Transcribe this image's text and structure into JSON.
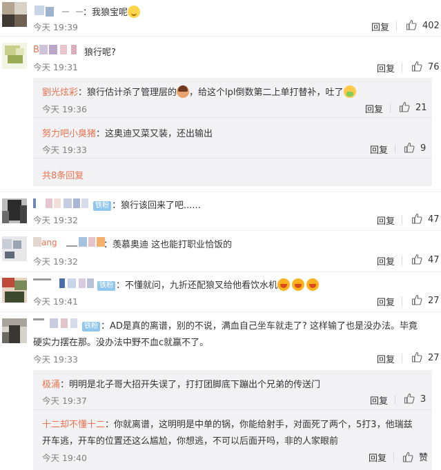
{
  "comments": [
    {
      "text": "我狼宝呢",
      "time": "今天 19:39",
      "reply": "回复",
      "likes": "402",
      "colors": [
        "#b3a58f",
        "#6f6253",
        "#d8d2c6",
        "#3e3a33"
      ]
    },
    {
      "text": "狼行呢?",
      "time": "今天 19:31",
      "reply": "回复",
      "likes": "76",
      "name_visible": "B",
      "colors": [
        "#c7d08a",
        "#f3f5e4",
        "#9bab55",
        "#e1e7bb"
      ],
      "replies": [
        {
          "name": "劉光炫彩",
          "text_before": "狼行估计杀了管理层的",
          "text_after": "，给这个lpl倒数第二上单打替补，吐了",
          "time": "今天 19:36",
          "reply": "回复",
          "likes": "21"
        },
        {
          "name": "努力吧小臭猪",
          "text": "这奥迪又菜又装，还出输出",
          "time": "今天 19:33",
          "reply": "回复",
          "likes": "9"
        }
      ],
      "more": "共8条回复"
    },
    {
      "badge": "铁粉",
      "text": "狼行该回来了吧......",
      "time": "今天 19:32",
      "reply": "回复",
      "likes": "47",
      "colors": [
        "#2b2b2b",
        "#6a6a6a",
        "#bdbdbd",
        "#444444"
      ]
    },
    {
      "name_visible": "ang",
      "text": "羡慕奥迪 这也能打职业恰饭的",
      "time": "今天 19:32",
      "reply": "回复",
      "likes": "47",
      "colors": [
        "#e8e8ea",
        "#9aa5b1",
        "#c9ced6",
        "#5f6b7a"
      ]
    },
    {
      "badge": "铁粉",
      "text": "不懂就问，九折还配狼叉给他看饮水机",
      "time": "今天 19:41",
      "reply": "回复",
      "likes": "27",
      "colors": [
        "#c04a3a",
        "#7a8a58",
        "#e6d3c0",
        "#3d4a2e"
      ]
    },
    {
      "badge": "铁粉",
      "text_line1": "AD是真的离谱，别的不说，满血自己坐车就走了? 这样输了也是没办法。毕竟",
      "text_line2": "硬实力摆在那。没办法中野不血c就赢不了。",
      "time": "今天 19:33",
      "reply": "回复",
      "likes": "27",
      "colors": [
        "#6d6a66",
        "#d7d2cc",
        "#3a3633",
        "#a8a39c"
      ],
      "replies": [
        {
          "name": "极涌",
          "text": "明明是北子哥大招开失误了，打打团脚底下蹦出个兄弟的传送门",
          "time": "今天 19:37",
          "reply": "回复",
          "likes": "3"
        },
        {
          "name": "十二却不懂十二",
          "text_line1": "你就离谱，这明明是中单的锅，你能给射手，对面死了两个，5打3，他瑞兹",
          "text_line2": "开车逃，开车的位置还这么尴尬，你想逃，不可以后面开吗，非的人家眼前",
          "time": "今天 19:40",
          "reply": "回复",
          "likes": "赞"
        }
      ]
    }
  ],
  "accent_color": "#eb7350",
  "icons": {
    "like": "thumbs-up-icon"
  }
}
